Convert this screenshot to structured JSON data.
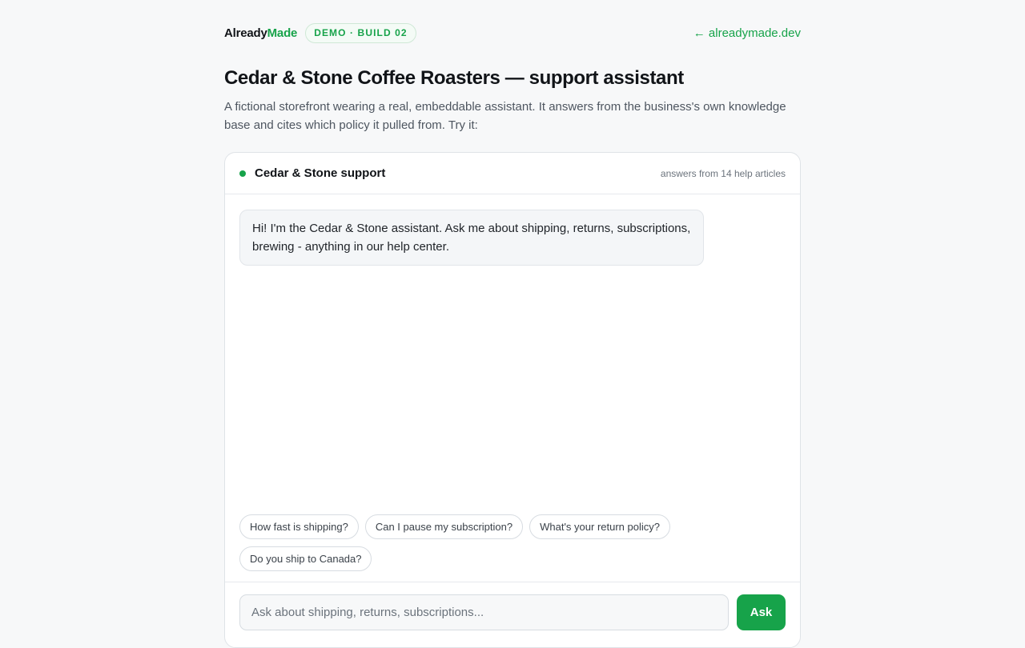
{
  "header": {
    "brand_part1": "Already",
    "brand_part2": "Made",
    "badge": "DEMO · BUILD 02",
    "back_link": "← alreadymade.dev"
  },
  "page": {
    "title": "Cedar & Stone Coffee Roasters — support assistant",
    "description": "A fictional storefront wearing a real, embeddable assistant. It answers from the business's own knowledge base and cites which policy it pulled from. Try it:"
  },
  "widget": {
    "title": "Cedar & Stone support",
    "meta": "answers from 14 help articles",
    "status_color": "#17a34a",
    "messages": [
      {
        "role": "assistant",
        "text": "Hi! I'm the Cedar & Stone assistant. Ask me about shipping, returns, subscriptions, brewing - anything in our help center."
      }
    ],
    "suggestions": [
      "How fast is shipping?",
      "Can I pause my subscription?",
      "What's your return policy?",
      "Do you ship to Canada?"
    ],
    "input": {
      "placeholder": "Ask about shipping, returns, subscriptions...",
      "value": ""
    },
    "ask_label": "Ask"
  },
  "colors": {
    "accent": "#17a34a",
    "background": "#f7f8f9"
  }
}
